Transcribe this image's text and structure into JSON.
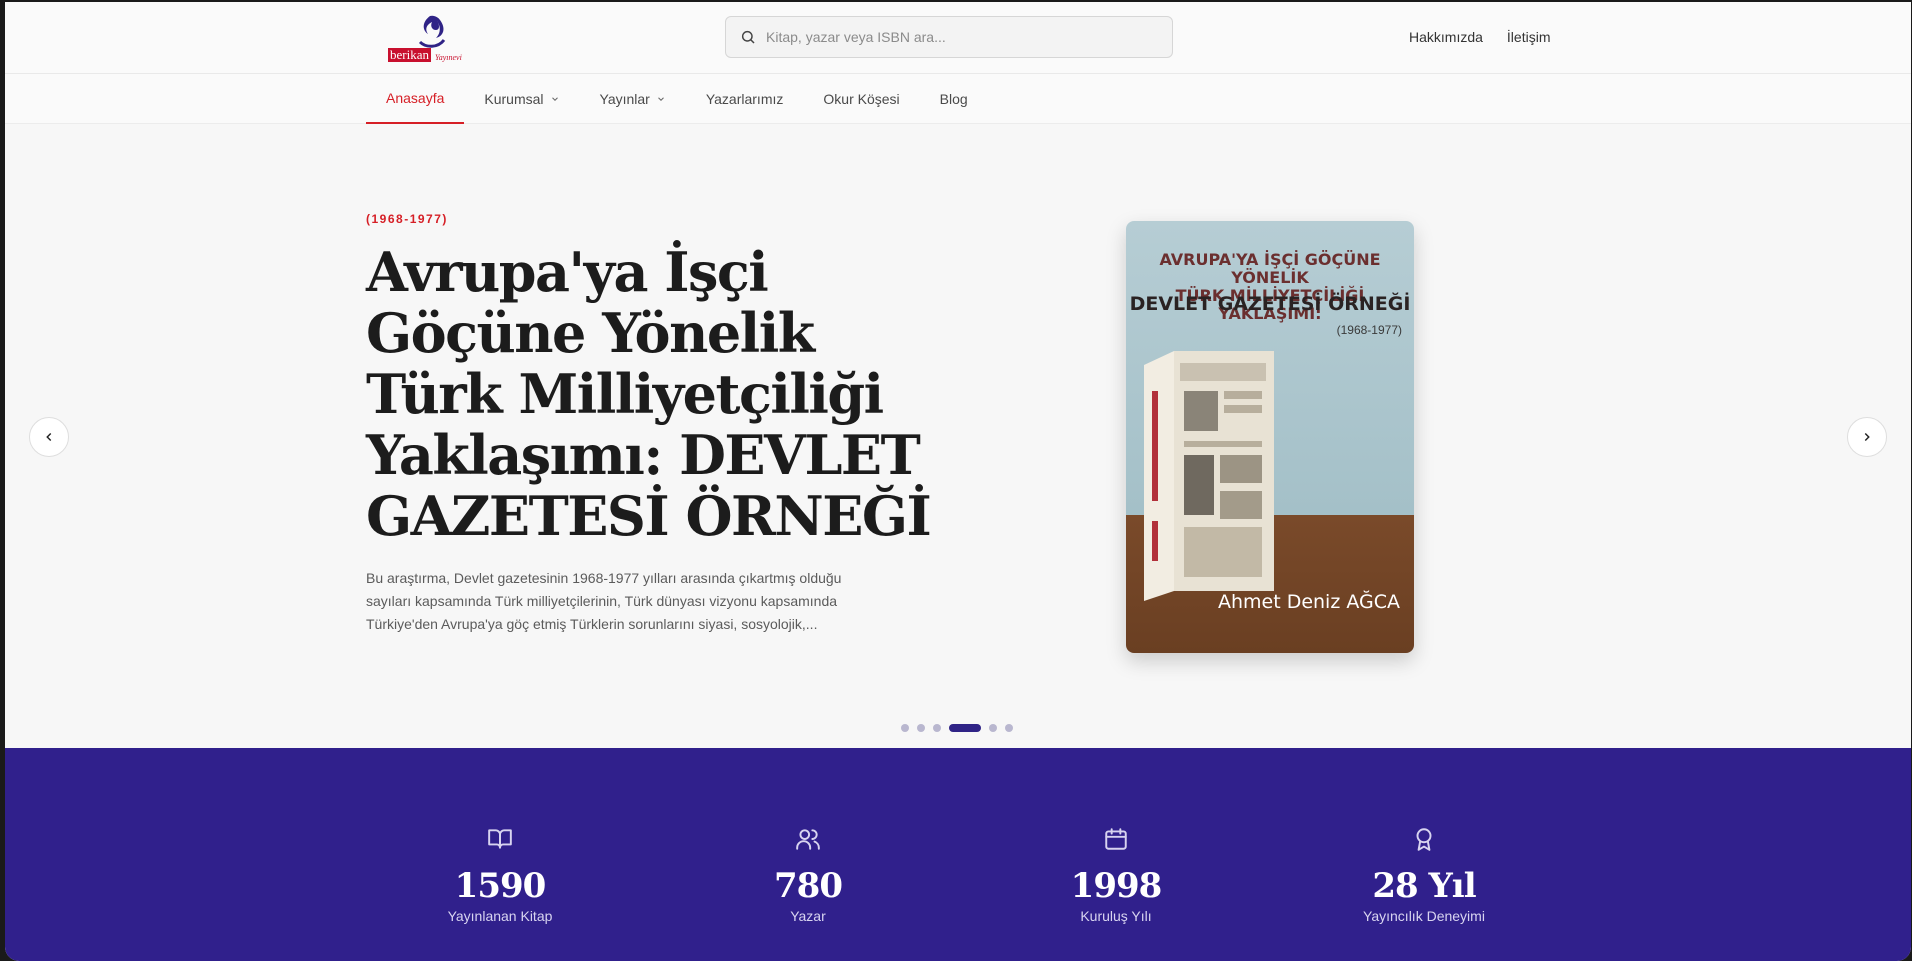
{
  "header": {
    "logo_word": "berikan",
    "logo_sub": "Yayınevi",
    "search_placeholder": "Kitap, yazar veya ISBN ara...",
    "links": [
      "Hakkımızda",
      "İletişim"
    ]
  },
  "nav": {
    "items": [
      {
        "label": "Anasayfa",
        "active": true,
        "dropdown": false
      },
      {
        "label": "Kurumsal",
        "active": false,
        "dropdown": true
      },
      {
        "label": "Yayınlar",
        "active": false,
        "dropdown": true
      },
      {
        "label": "Yazarlarımız",
        "active": false,
        "dropdown": false
      },
      {
        "label": "Okur Köşesi",
        "active": false,
        "dropdown": false
      },
      {
        "label": "Blog",
        "active": false,
        "dropdown": false
      }
    ]
  },
  "hero": {
    "eyebrow": "(1968-1977)",
    "title": "Avrupa'ya İşçi Göçüne Yönelik Türk Milliyetçiliği Yaklaşımı: DEVLET GAZETESİ ÖRNEĞİ",
    "description": "Bu araştırma, Devlet gazetesinin 1968-1977 yılları arasında çıkartmış olduğu sayıları kapsamında Türk milliyetçilerinin, Türk dünyası vizyonu kapsamında Türkiye'den Avrupa'ya göç etmiş Türklerin sorunlarını siyasi, sosyolojik,...",
    "cover": {
      "title_line1": "AVRUPA'YA İŞÇİ GÖÇÜNE YÖNELİK",
      "title_line2": "TÜRK MİLLİYETÇİLİĞİ YAKLAŞIMI:",
      "title_main": "DEVLET GAZETESİ ÖRNEĞİ",
      "years": "(1968-1977)",
      "author": "Ahmet Deniz AĞCA"
    },
    "carousel": {
      "count": 6,
      "active_index": 3
    }
  },
  "stats": [
    {
      "icon": "book-open-icon",
      "value": "1590",
      "label": "Yayınlanan Kitap"
    },
    {
      "icon": "users-icon",
      "value": "780",
      "label": "Yazar"
    },
    {
      "icon": "calendar-icon",
      "value": "1998",
      "label": "Kuruluş Yılı"
    },
    {
      "icon": "award-icon",
      "value": "28 Yıl",
      "label": "Yayıncılık Deneyimi"
    }
  ],
  "colors": {
    "accent": "#d61f26",
    "brand_purple": "#30208c",
    "dot_active": "#2f2386"
  }
}
